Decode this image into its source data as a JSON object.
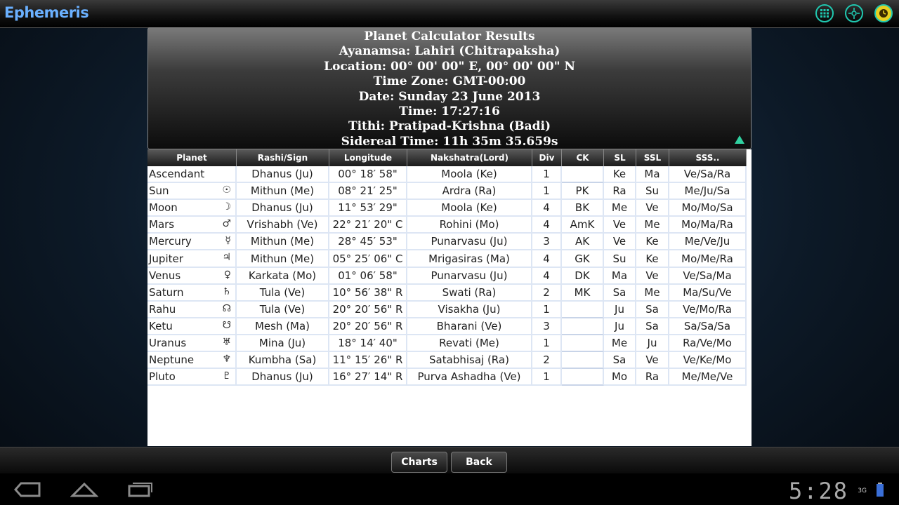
{
  "app": {
    "title": "Ephemeris"
  },
  "header": {
    "lines": [
      "Planet Calculator Results",
      "Ayanamsa: Lahiri (Chitrapaksha)",
      "Location: 00° 00' 00\" E, 00° 00' 00\" N",
      "Time Zone: GMT-00:00",
      "Date: Sunday 23 June 2013",
      "Time: 17:27:16",
      "Tithi: Pratipad-Krishna (Badi)",
      "Sidereal Time: 11h 35m 35.659s"
    ]
  },
  "table": {
    "columns": [
      "Planet",
      "Rashi/Sign",
      "Longitude",
      "Nakshatra(Lord)",
      "Div",
      "CK",
      "SL",
      "SSL",
      "SSS.."
    ],
    "rows": [
      {
        "planet": "Ascendant",
        "symbol": "",
        "rashi": "Dhanus (Ju)",
        "longitude": "00° 18′ 58\"",
        "nakshatra": "Moola (Ke)",
        "div": "1",
        "ck": "",
        "sl": "Ke",
        "ssl": "Ma",
        "sss": "Ve/Sa/Ra"
      },
      {
        "planet": "Sun",
        "symbol": "☉",
        "rashi": "Mithun (Me)",
        "longitude": "08° 21′ 25\"",
        "nakshatra": "Ardra (Ra)",
        "div": "1",
        "ck": "PK",
        "sl": "Ra",
        "ssl": "Su",
        "sss": "Me/Ju/Sa"
      },
      {
        "planet": "Moon",
        "symbol": "☽",
        "rashi": "Dhanus (Ju)",
        "longitude": "11° 53′ 29\"",
        "nakshatra": "Moola (Ke)",
        "div": "4",
        "ck": "BK",
        "sl": "Me",
        "ssl": "Ve",
        "sss": "Mo/Mo/Sa"
      },
      {
        "planet": "Mars",
        "symbol": "♂",
        "rashi": "Vrishabh (Ve)",
        "longitude": "22° 21′ 20\" C",
        "nakshatra": "Rohini (Mo)",
        "div": "4",
        "ck": "AmK",
        "sl": "Ve",
        "ssl": "Me",
        "sss": "Mo/Ma/Ra"
      },
      {
        "planet": "Mercury",
        "symbol": "☿",
        "rashi": "Mithun (Me)",
        "longitude": "28° 45′ 53\"",
        "nakshatra": "Punarvasu (Ju)",
        "div": "3",
        "ck": "AK",
        "sl": "Ve",
        "ssl": "Ke",
        "sss": "Me/Ve/Ju"
      },
      {
        "planet": "Jupiter",
        "symbol": "♃",
        "rashi": "Mithun (Me)",
        "longitude": "05° 25′ 06\" C",
        "nakshatra": "Mrigasiras (Ma)",
        "div": "4",
        "ck": "GK",
        "sl": "Su",
        "ssl": "Ke",
        "sss": "Mo/Me/Ra"
      },
      {
        "planet": "Venus",
        "symbol": "♀",
        "rashi": "Karkata (Mo)",
        "longitude": "01° 06′ 58\"",
        "nakshatra": "Punarvasu (Ju)",
        "div": "4",
        "ck": "DK",
        "sl": "Ma",
        "ssl": "Ve",
        "sss": "Ve/Sa/Ma"
      },
      {
        "planet": "Saturn",
        "symbol": "♄",
        "rashi": "Tula (Ve)",
        "longitude": "10° 56′ 38\" R",
        "nakshatra": "Swati (Ra)",
        "div": "2",
        "ck": "MK",
        "sl": "Sa",
        "ssl": "Me",
        "sss": "Ma/Su/Ve"
      },
      {
        "planet": "Rahu",
        "symbol": "☊",
        "rashi": "Tula (Ve)",
        "longitude": "20° 20′ 56\" R",
        "nakshatra": "Visakha (Ju)",
        "div": "1",
        "ck": "",
        "sl": "Ju",
        "ssl": "Sa",
        "sss": "Ve/Mo/Ra"
      },
      {
        "planet": "Ketu",
        "symbol": "☋",
        "rashi": "Mesh (Ma)",
        "longitude": "20° 20′ 56\" R",
        "nakshatra": "Bharani (Ve)",
        "div": "3",
        "ck": "",
        "sl": "Ju",
        "ssl": "Sa",
        "sss": "Sa/Sa/Sa"
      },
      {
        "planet": "Uranus",
        "symbol": "♅",
        "rashi": "Mina (Ju)",
        "longitude": "18° 14′ 40\"",
        "nakshatra": "Revati (Me)",
        "div": "1",
        "ck": "",
        "sl": "Me",
        "ssl": "Ju",
        "sss": "Ra/Ve/Mo"
      },
      {
        "planet": "Neptune",
        "symbol": "♆",
        "rashi": "Kumbha (Sa)",
        "longitude": "11° 15′ 26\" R",
        "nakshatra": "Satabhisaj (Ra)",
        "div": "2",
        "ck": "",
        "sl": "Sa",
        "ssl": "Ve",
        "sss": "Ve/Ke/Mo"
      },
      {
        "planet": "Pluto",
        "symbol": "♇",
        "rashi": "Dhanus (Ju)",
        "longitude": "16° 27′ 14\" R",
        "nakshatra": "Purva Ashadha (Ve)",
        "div": "1",
        "ck": "",
        "sl": "Mo",
        "ssl": "Ra",
        "sss": "Me/Me/Ve"
      }
    ]
  },
  "buttons": {
    "charts": "Charts",
    "back": "Back"
  },
  "status": {
    "clock": "5:28",
    "network": "3G"
  },
  "icons": {
    "top_right": [
      "grid-menu-icon",
      "compass-icon",
      "clock-settings-icon"
    ],
    "nav": [
      "back-icon",
      "home-icon",
      "recent-apps-icon"
    ]
  },
  "colors": {
    "title_blue": "#6ab0ff",
    "icon_teal": "#20c8b0"
  }
}
